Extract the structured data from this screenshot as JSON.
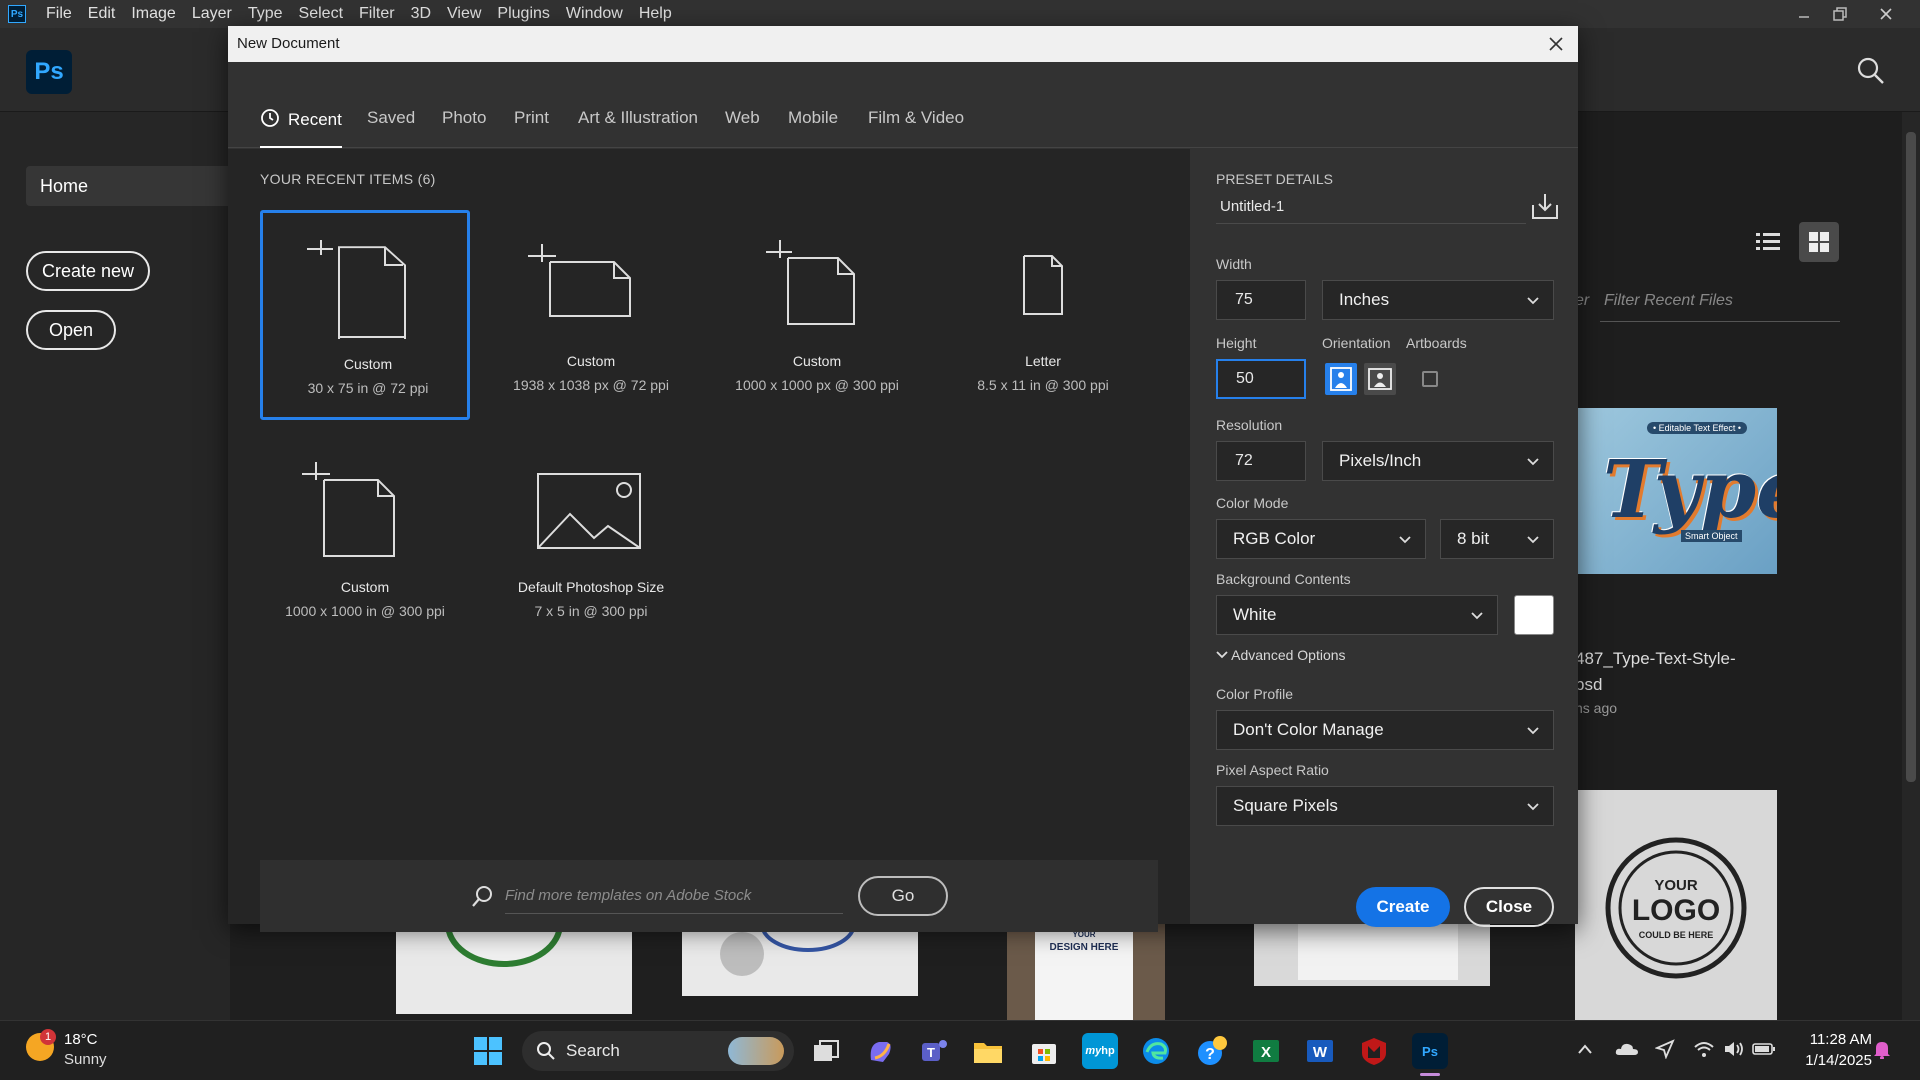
{
  "menubar": {
    "app_badge": "Ps",
    "items": [
      "File",
      "Edit",
      "Image",
      "Layer",
      "Type",
      "Select",
      "Filter",
      "3D",
      "View",
      "Plugins",
      "Window",
      "Help"
    ]
  },
  "home": {
    "logo": "Ps",
    "nav_home": "Home",
    "create_new": "Create new",
    "open": "Open",
    "filter_prefix": "er",
    "filter_placeholder": "Filter Recent Files",
    "thumb_type_tag": "• Editable Text Effect •",
    "thumb_type_word": "Type",
    "thumb_type_sub": "Smart Object",
    "file_name_line1": "487_Type-Text-Style-",
    "file_name_line2": "psd",
    "file_age": "ns ago",
    "logo_thumb_line1": "YOUR",
    "logo_thumb_line2": "LOGO",
    "logo_thumb_line3": "COULD BE HERE",
    "design_here_line1": "YOUR",
    "design_here_line2": "DESIGN HERE"
  },
  "dialog": {
    "title": "New Document",
    "tabs": [
      "Recent",
      "Saved",
      "Photo",
      "Print",
      "Art & Illustration",
      "Web",
      "Mobile",
      "Film & Video"
    ],
    "active_tab": "Recent",
    "recent_heading": "YOUR RECENT ITEMS  (6)",
    "recent_items": [
      {
        "name": "Custom",
        "size": "30 x 75 in @ 72 ppi",
        "selected": true,
        "icon": "custom-document-icon"
      },
      {
        "name": "Custom",
        "size": "1938 x 1038 px @ 72 ppi",
        "selected": false,
        "icon": "custom-landscape-document-icon"
      },
      {
        "name": "Custom",
        "size": "1000 x 1000 px @ 300 ppi",
        "selected": false,
        "icon": "custom-square-document-icon"
      },
      {
        "name": "Letter",
        "size": "8.5 x 11 in @ 300 ppi",
        "selected": false,
        "icon": "letter-document-icon"
      },
      {
        "name": "Custom",
        "size": "1000 x 1000 in @ 300 ppi",
        "selected": false,
        "icon": "custom-document-icon"
      },
      {
        "name": "Default Photoshop Size",
        "size": "7 x 5 in @ 300 ppi",
        "selected": false,
        "icon": "image-placeholder-icon"
      }
    ],
    "stock_placeholder": "Find more templates on Adobe Stock",
    "go_label": "Go",
    "preset": {
      "heading": "PRESET DETAILS",
      "name": "Untitled-1",
      "width_label": "Width",
      "width": "75",
      "width_unit": "Inches",
      "height_label": "Height",
      "height": "50",
      "orientation_label": "Orientation",
      "artboards_label": "Artboards",
      "resolution_label": "Resolution",
      "resolution": "72",
      "resolution_unit": "Pixels/Inch",
      "color_mode_label": "Color Mode",
      "color_mode": "RGB Color",
      "bit_depth": "8 bit",
      "bg_label": "Background Contents",
      "bg_value": "White",
      "bg_color": "#ffffff",
      "advanced_label": "Advanced Options",
      "color_profile_label": "Color Profile",
      "color_profile": "Don't Color Manage",
      "pixel_aspect_label": "Pixel Aspect Ratio",
      "pixel_aspect": "Square Pixels"
    },
    "create_label": "Create",
    "close_label": "Close"
  },
  "taskbar": {
    "weather_badge": "1",
    "weather_temp": "18°C",
    "weather_desc": "Sunny",
    "search_label": "Search",
    "time": "11:28 AM",
    "date": "1/14/2025",
    "apps": [
      "start-icon",
      "task-view-icon",
      "copilot-icon",
      "teams-icon",
      "file-explorer-icon",
      "microsoft-store-icon",
      "myhp-icon",
      "edge-icon",
      "get-help-icon",
      "excel-icon",
      "word-icon",
      "mcafee-icon",
      "photoshop-icon"
    ]
  },
  "colors": {
    "accent": "#2680eb",
    "create_button": "#1473e6",
    "photoshop_blue": "#31a8ff"
  }
}
